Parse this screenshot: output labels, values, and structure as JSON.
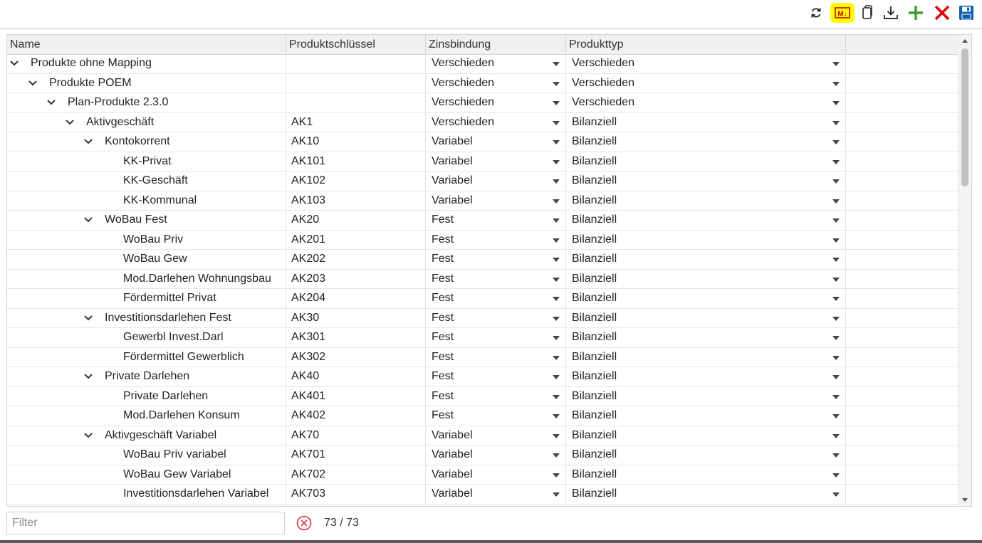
{
  "toolbar": {
    "buttons": [
      {
        "name": "refresh-icon"
      },
      {
        "name": "markdown-icon",
        "label": "M↓",
        "highlight": "#ffff00",
        "color": "#d00000"
      },
      {
        "name": "copy-icon"
      },
      {
        "name": "download-icon"
      },
      {
        "name": "add-icon",
        "color": "#3a9a2a"
      },
      {
        "name": "delete-icon",
        "color": "#e00000"
      },
      {
        "name": "save-icon",
        "color": "#1060b0"
      }
    ]
  },
  "grid": {
    "columns": [
      "Name",
      "Produktschlüssel",
      "Zinsbindung",
      "Produkttyp"
    ],
    "rows": [
      {
        "level": 0,
        "expanded": true,
        "name": "Produkte ohne Mapping",
        "key": "",
        "zins": "Verschieden",
        "typ": "Verschieden"
      },
      {
        "level": 1,
        "expanded": true,
        "name": "Produkte POEM",
        "key": "",
        "zins": "Verschieden",
        "typ": "Verschieden"
      },
      {
        "level": 2,
        "expanded": true,
        "name": "Plan-Produkte 2.3.0",
        "key": "",
        "zins": "Verschieden",
        "typ": "Verschieden"
      },
      {
        "level": 3,
        "expanded": true,
        "name": "Aktivgeschäft",
        "key": "AK1",
        "zins": "Verschieden",
        "typ": "Bilanziell"
      },
      {
        "level": 4,
        "expanded": true,
        "name": "Kontokorrent",
        "key": "AK10",
        "zins": "Variabel",
        "typ": "Bilanziell"
      },
      {
        "level": 5,
        "expanded": false,
        "name": "KK-Privat",
        "key": "AK101",
        "zins": "Variabel",
        "typ": "Bilanziell"
      },
      {
        "level": 5,
        "expanded": false,
        "name": "KK-Geschäft",
        "key": "AK102",
        "zins": "Variabel",
        "typ": "Bilanziell"
      },
      {
        "level": 5,
        "expanded": false,
        "name": "KK-Kommunal",
        "key": "AK103",
        "zins": "Variabel",
        "typ": "Bilanziell"
      },
      {
        "level": 4,
        "expanded": true,
        "name": "WoBau Fest",
        "key": "AK20",
        "zins": "Fest",
        "typ": "Bilanziell"
      },
      {
        "level": 5,
        "expanded": false,
        "name": "WoBau Priv",
        "key": "AK201",
        "zins": "Fest",
        "typ": "Bilanziell"
      },
      {
        "level": 5,
        "expanded": false,
        "name": "WoBau Gew",
        "key": "AK202",
        "zins": "Fest",
        "typ": "Bilanziell"
      },
      {
        "level": 5,
        "expanded": false,
        "name": "Mod.Darlehen Wohnungsbau",
        "key": "AK203",
        "zins": "Fest",
        "typ": "Bilanziell"
      },
      {
        "level": 5,
        "expanded": false,
        "name": "Fördermittel Privat",
        "key": "AK204",
        "zins": "Fest",
        "typ": "Bilanziell"
      },
      {
        "level": 4,
        "expanded": true,
        "name": "Investitionsdarlehen Fest",
        "key": "AK30",
        "zins": "Fest",
        "typ": "Bilanziell"
      },
      {
        "level": 5,
        "expanded": false,
        "name": "Gewerbl Invest.Darl",
        "key": "AK301",
        "zins": "Fest",
        "typ": "Bilanziell"
      },
      {
        "level": 5,
        "expanded": false,
        "name": "Fördermittel Gewerblich",
        "key": "AK302",
        "zins": "Fest",
        "typ": "Bilanziell"
      },
      {
        "level": 4,
        "expanded": true,
        "name": "Private Darlehen",
        "key": "AK40",
        "zins": "Fest",
        "typ": "Bilanziell"
      },
      {
        "level": 5,
        "expanded": false,
        "name": "Private Darlehen",
        "key": "AK401",
        "zins": "Fest",
        "typ": "Bilanziell"
      },
      {
        "level": 5,
        "expanded": false,
        "name": "Mod.Darlehen Konsum",
        "key": "AK402",
        "zins": "Fest",
        "typ": "Bilanziell"
      },
      {
        "level": 4,
        "expanded": true,
        "name": "Aktivgeschäft Variabel",
        "key": "AK70",
        "zins": "Variabel",
        "typ": "Bilanziell"
      },
      {
        "level": 5,
        "expanded": false,
        "name": "WoBau Priv variabel",
        "key": "AK701",
        "zins": "Variabel",
        "typ": "Bilanziell"
      },
      {
        "level": 5,
        "expanded": false,
        "name": "WoBau Gew Variabel",
        "key": "AK702",
        "zins": "Variabel",
        "typ": "Bilanziell"
      },
      {
        "level": 5,
        "expanded": false,
        "name": "Investitionsdarlehen Variabel",
        "key": "AK703",
        "zins": "Variabel",
        "typ": "Bilanziell"
      }
    ]
  },
  "footer": {
    "filter_placeholder": "Filter",
    "filter_value": "",
    "count": "73 / 73"
  }
}
